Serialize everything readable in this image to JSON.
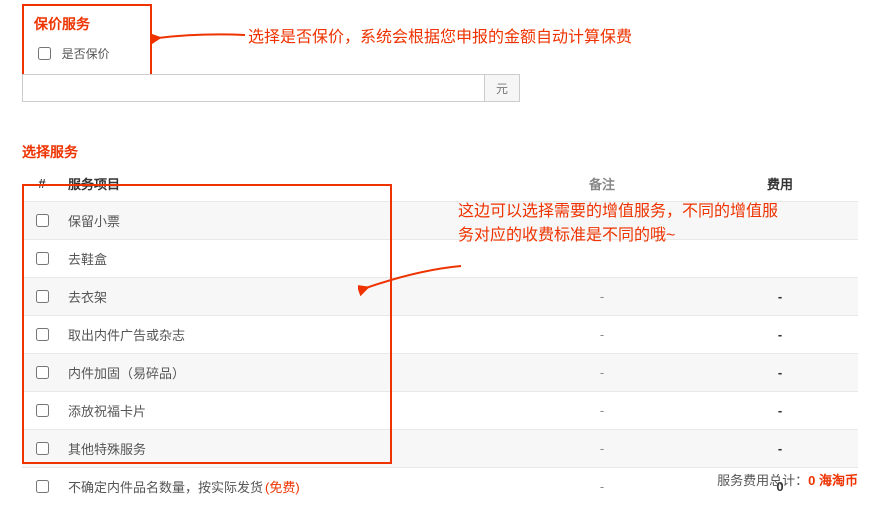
{
  "insure": {
    "title": "保价服务",
    "checkbox_label": "是否保价",
    "amount_value": "",
    "unit": "元"
  },
  "annotations": {
    "line1": "选择是否保价，系统会根据您申报的金额自动计算保费",
    "line2": "这边可以选择需要的增值服务，不同的增值服务对应的收费标准是不同的哦~"
  },
  "services": {
    "title": "选择服务",
    "headers": {
      "idx": "#",
      "name": "服务项目",
      "note": "备注",
      "fee": "费用"
    },
    "rows": [
      {
        "name": "保留小票",
        "note": "",
        "fee": ""
      },
      {
        "name": "去鞋盒",
        "note": "",
        "fee": ""
      },
      {
        "name": "去衣架",
        "note": "-",
        "fee": "-"
      },
      {
        "name": "取出内件广告或杂志",
        "note": "-",
        "fee": "-"
      },
      {
        "name": "内件加固（易碎品）",
        "note": "-",
        "fee": "-"
      },
      {
        "name": "添放祝福卡片",
        "note": "-",
        "fee": "-"
      },
      {
        "name": "其他特殊服务",
        "note": "-",
        "fee": "-"
      },
      {
        "name": "不确定内件品名数量，按实际发货",
        "note": "-",
        "fee": "0",
        "free": "(免费)"
      }
    ]
  },
  "totals": {
    "label": "服务费用总计：",
    "value": "0",
    "currency": " 海淘币"
  },
  "colors": {
    "accent": "#e30"
  }
}
